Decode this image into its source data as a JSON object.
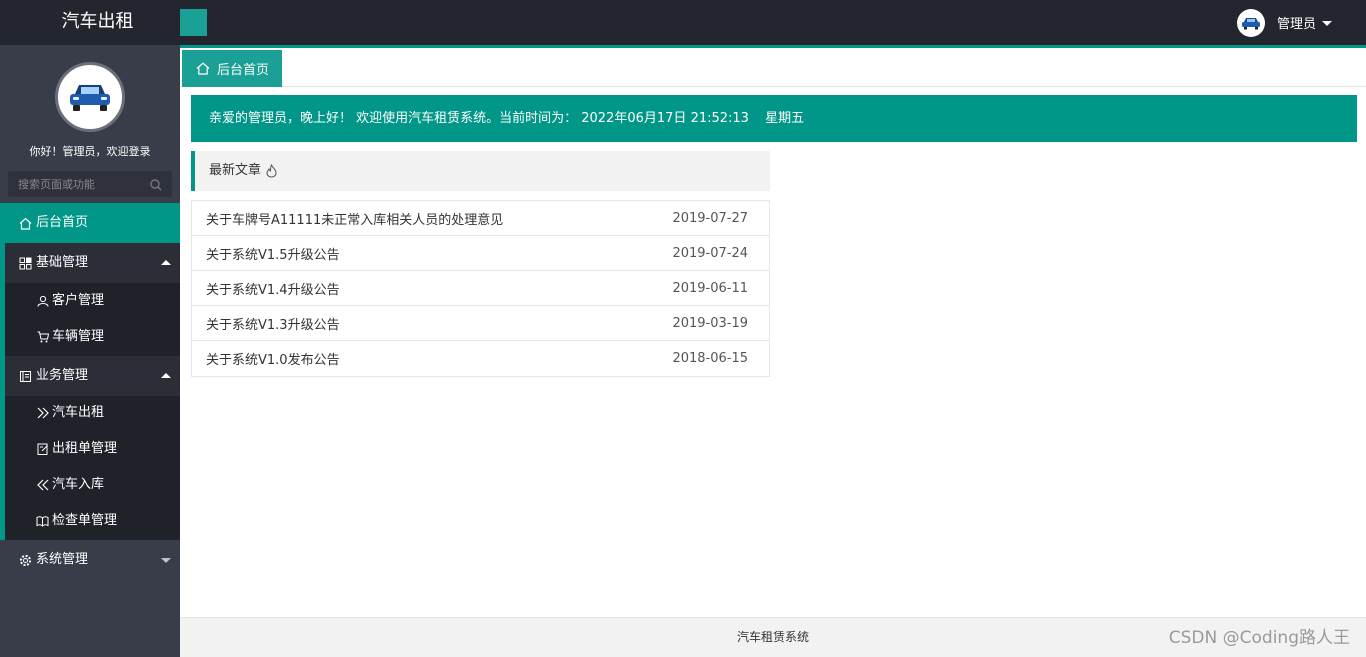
{
  "header": {
    "logo": "汽车出租",
    "user_name": "管理员"
  },
  "sidebar": {
    "welcome": "你好！管理员，欢迎登录",
    "search_placeholder": "搜索页面或功能",
    "home": "后台首页",
    "groups": [
      {
        "label": "基础管理",
        "items": [
          "客户管理",
          "车辆管理"
        ]
      },
      {
        "label": "业务管理",
        "items": [
          "汽车出租",
          "出租单管理",
          "汽车入库",
          "检查单管理"
        ]
      },
      {
        "label": "系统管理",
        "items": []
      }
    ]
  },
  "main": {
    "tab_label": "后台首页",
    "notice": {
      "greeting": "亲爱的管理员，晚上好！ 欢迎使用汽车租赁系统。当前时间为： 2022年06月17日 21:52:13",
      "weekday": "星期五"
    },
    "articles_title": "最新文章",
    "articles": [
      {
        "title": "关于车牌号A11111未正常入库相关人员的处理意见",
        "date": "2019-07-27"
      },
      {
        "title": "关于系统V1.5升级公告",
        "date": "2019-07-24"
      },
      {
        "title": "关于系统V1.4升级公告",
        "date": "2019-06-11"
      },
      {
        "title": "关于系统V1.3升级公告",
        "date": "2019-03-19"
      },
      {
        "title": "关于系统V1.0发布公告",
        "date": "2018-06-15"
      }
    ]
  },
  "footer": {
    "text": "汽车租赁系统",
    "watermark": "CSDN @Coding路人王"
  },
  "colors": {
    "accent": "#009688",
    "header_bg": "#23262e",
    "sidebar_bg": "#393d49"
  }
}
